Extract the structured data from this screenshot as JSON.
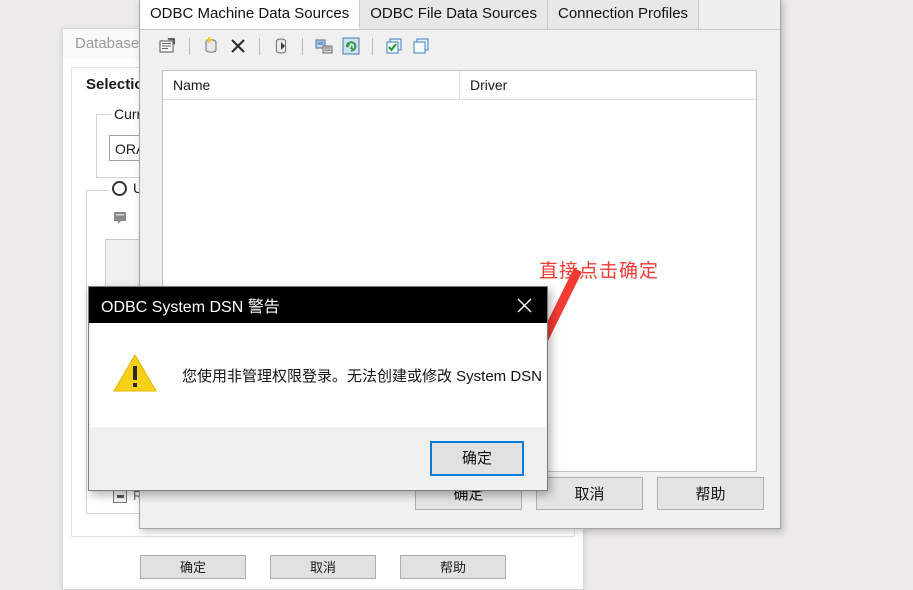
{
  "background_window": {
    "title": "Database Properties",
    "group_title": "Selection",
    "current_fieldset_label": "Current Database",
    "current_value": "ORACLE",
    "radio_label": "Using",
    "checkbox_label": "Remember",
    "buttons": [
      "确定",
      "取消",
      "帮助"
    ]
  },
  "odbc_window": {
    "tabs": [
      {
        "label": "ODBC Machine Data Sources",
        "active": true
      },
      {
        "label": "ODBC File Data Sources",
        "active": false
      },
      {
        "label": "Connection Profiles",
        "active": false
      }
    ],
    "toolbar_icons": [
      "properties-icon",
      "separator",
      "new-datasource-icon",
      "delete-icon",
      "separator",
      "database-icon",
      "separator",
      "server-icon",
      "refresh-icon",
      "separator",
      "test-connection-icon",
      "copy-icon"
    ],
    "list_columns": [
      "Name",
      "Driver"
    ],
    "list_rows": [],
    "buttons": [
      "确定",
      "取消",
      "帮助"
    ]
  },
  "annotation": {
    "text": "直接点击确定",
    "color": "#f33b34"
  },
  "warning_dialog": {
    "title": "ODBC System DSN 警告",
    "close_label": "✕",
    "icon": "warning-triangle-icon",
    "message": "您使用非管理权限登录。无法创建或修改 System DSN",
    "ok_label": "确定"
  }
}
